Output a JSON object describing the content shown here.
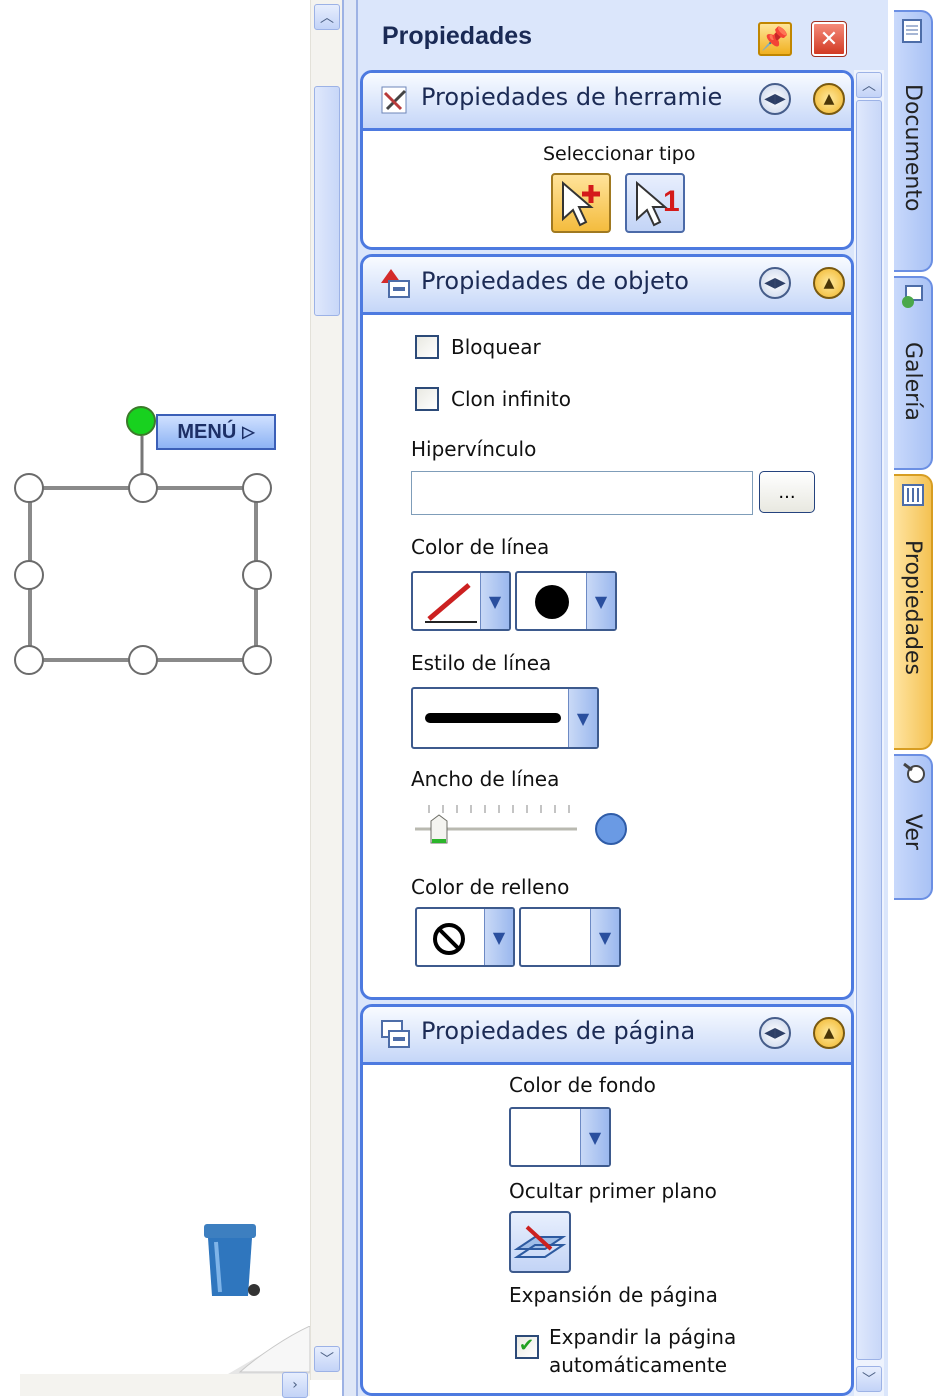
{
  "panel": {
    "title": "Propiedades"
  },
  "canvas": {
    "menu_label": "MENÚ"
  },
  "sections": {
    "tool": {
      "title": "Propiedades de herramie",
      "select_type_label": "Seleccionar tipo"
    },
    "object": {
      "title": "Propiedades de objeto",
      "lock_label": "Bloquear",
      "lock_checked": false,
      "clone_label": "Clon infinito",
      "clone_checked": false,
      "hyperlink_label": "Hipervínculo",
      "hyperlink_value": "",
      "browse_label": "...",
      "line_color_label": "Color de línea",
      "line_style_label": "Estilo de línea",
      "line_width_label": "Ancho de línea",
      "fill_color_label": "Color de relleno"
    },
    "page": {
      "title": "Propiedades de página",
      "bg_color_label": "Color de fondo",
      "hide_fg_label": "Ocultar primer plano",
      "page_expand_label": "Expansión de página",
      "auto_expand_label_1": "Expandir la página",
      "auto_expand_label_2": "automáticamente",
      "auto_expand_checked": true
    }
  },
  "tabs": [
    {
      "label": "Documento",
      "active": false
    },
    {
      "label": "Galería",
      "active": false
    },
    {
      "label": "Propiedades",
      "active": true
    },
    {
      "label": "Ver",
      "active": false
    }
  ],
  "colors": {
    "accent": "#4d7ae0",
    "panel_bg": "#dbe6fb",
    "active_tab": "#f4c253",
    "rotate_handle": "#18d11f"
  }
}
